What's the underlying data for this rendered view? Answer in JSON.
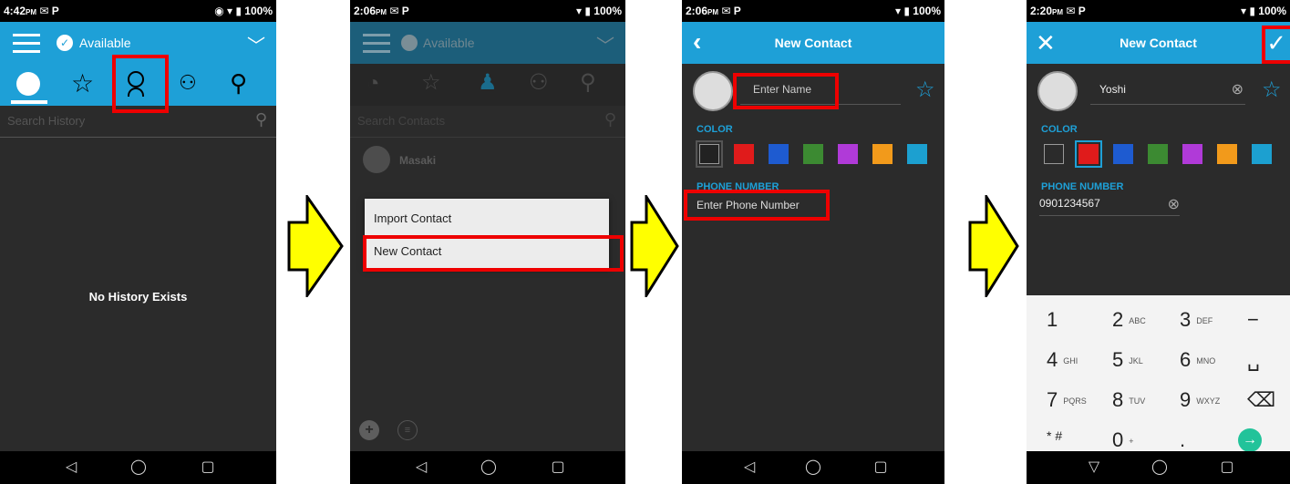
{
  "colors": {
    "accent": "#1ea0d7",
    "highlight": "#ee0000",
    "arrow_fill": "#ffff00"
  },
  "screen1": {
    "time": "4:42",
    "time_suffix": "PM",
    "battery": "100%",
    "status_label": "Available",
    "search_placeholder": "Search History",
    "empty_text": "No History Exists",
    "tabs": [
      "history-icon",
      "favorites-icon",
      "contacts-icon",
      "groups-icon",
      "location-icon"
    ]
  },
  "screen2": {
    "time": "2:06",
    "time_suffix": "PM",
    "battery": "100%",
    "status_label": "Available",
    "search_placeholder": "Search Contacts",
    "contact_name": "Masaki",
    "menu_items": [
      "Import Contact",
      "New Contact"
    ]
  },
  "screen3": {
    "time": "2:06",
    "time_suffix": "PM",
    "battery": "100%",
    "title": "New Contact",
    "name_placeholder": "Enter Name",
    "color_label": "COLOR",
    "phone_label": "PHONE NUMBER",
    "phone_placeholder": "Enter Phone Number",
    "swatches": [
      "#222222",
      "#e01b1b",
      "#1e5bd0",
      "#3c8a32",
      "#b03ad8",
      "#f29a1b",
      "#1ca0d0"
    ]
  },
  "screen4": {
    "time": "2:20",
    "time_suffix": "PM",
    "battery": "100%",
    "title": "New Contact",
    "name_value": "Yoshi",
    "color_label": "COLOR",
    "phone_label": "PHONE NUMBER",
    "phone_value": "0901234567",
    "swatches": [
      "#ffffff",
      "#e01b1b",
      "#1e5bd0",
      "#3c8a32",
      "#b03ad8",
      "#f29a1b",
      "#1ca0d0"
    ],
    "keypad": [
      {
        "main": "1",
        "sub": ""
      },
      {
        "main": "2",
        "sub": "ABC"
      },
      {
        "main": "3",
        "sub": "DEF"
      },
      {
        "main": "−",
        "sub": ""
      },
      {
        "main": "4",
        "sub": "GHI"
      },
      {
        "main": "5",
        "sub": "JKL"
      },
      {
        "main": "6",
        "sub": "MNO"
      },
      {
        "main": "␣",
        "sub": ""
      },
      {
        "main": "7",
        "sub": "PQRS"
      },
      {
        "main": "8",
        "sub": "TUV"
      },
      {
        "main": "9",
        "sub": "WXYZ"
      },
      {
        "main": "⌫",
        "sub": ""
      },
      {
        "main": "* #",
        "sub": ""
      },
      {
        "main": "0",
        "sub": "+"
      },
      {
        "main": ".",
        "sub": ""
      },
      {
        "main": "→",
        "sub": ""
      }
    ]
  }
}
